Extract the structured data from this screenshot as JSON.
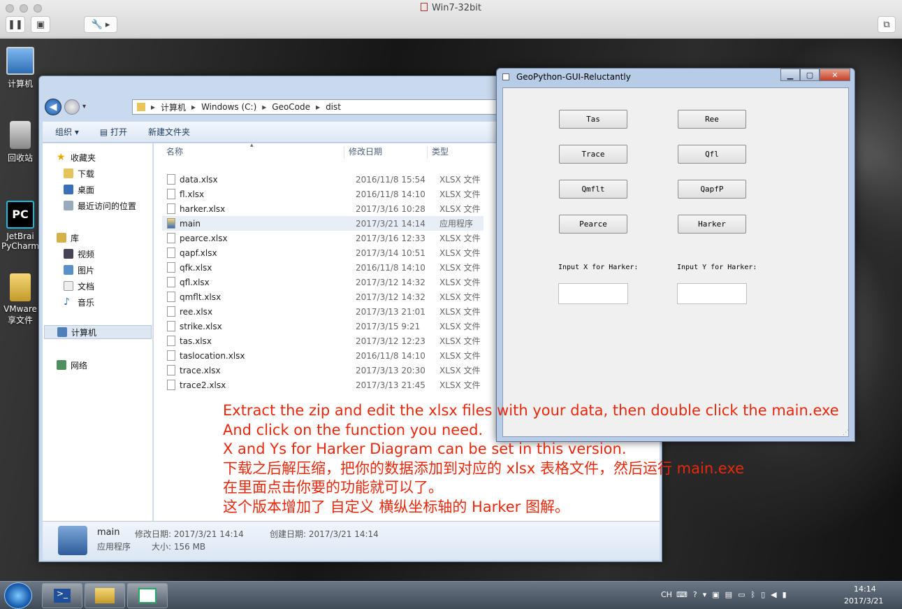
{
  "host": {
    "title": "Win7-32bit"
  },
  "desktop": {
    "icons": [
      "计算机",
      "回收站",
      "JetBrains PyCharm",
      "VMware 共享文件夹"
    ],
    "icon_labels_visible": [
      "计算机",
      "回收站",
      "JetBrai",
      "PyCharm",
      "VMware",
      "享文件"
    ]
  },
  "explorer": {
    "breadcrumb": [
      "计算机",
      "Windows (C:)",
      "GeoCode",
      "dist"
    ],
    "toolbar": {
      "organize": "组织",
      "open": "打开",
      "new_folder": "新建文件夹"
    },
    "nav": {
      "favorites": "收藏夹",
      "downloads": "下载",
      "desktop": "桌面",
      "recent": "最近访问的位置",
      "libraries": "库",
      "videos": "视频",
      "pictures": "图片",
      "documents": "文档",
      "music": "音乐",
      "computer": "计算机",
      "network": "网络"
    },
    "columns": {
      "name": "名称",
      "date": "修改日期",
      "type": "类型"
    },
    "files": [
      {
        "name": "data.xlsx",
        "date": "2016/11/8 15:54",
        "type": "XLSX 文件"
      },
      {
        "name": "fl.xlsx",
        "date": "2016/11/8 14:10",
        "type": "XLSX 文件"
      },
      {
        "name": "harker.xlsx",
        "date": "2017/3/16 10:28",
        "type": "XLSX 文件"
      },
      {
        "name": "main",
        "date": "2017/3/21 14:14",
        "type": "应用程序"
      },
      {
        "name": "pearce.xlsx",
        "date": "2017/3/16 12:33",
        "type": "XLSX 文件"
      },
      {
        "name": "qapf.xlsx",
        "date": "2017/3/14 10:51",
        "type": "XLSX 文件"
      },
      {
        "name": "qfk.xlsx",
        "date": "2016/11/8 14:10",
        "type": "XLSX 文件"
      },
      {
        "name": "qfl.xlsx",
        "date": "2017/3/12 14:32",
        "type": "XLSX 文件"
      },
      {
        "name": "qmflt.xlsx",
        "date": "2017/3/12 14:32",
        "type": "XLSX 文件"
      },
      {
        "name": "ree.xlsx",
        "date": "2017/3/13 21:01",
        "type": "XLSX 文件"
      },
      {
        "name": "strike.xlsx",
        "date": "2017/3/15 9:21",
        "type": "XLSX 文件"
      },
      {
        "name": "tas.xlsx",
        "date": "2017/3/12 12:23",
        "type": "XLSX 文件"
      },
      {
        "name": "taslocation.xlsx",
        "date": "2016/11/8 14:10",
        "type": "XLSX 文件"
      },
      {
        "name": "trace.xlsx",
        "date": "2017/3/13 20:30",
        "type": "XLSX 文件"
      },
      {
        "name": "trace2.xlsx",
        "date": "2017/3/13 21:45",
        "type": "XLSX 文件"
      }
    ],
    "details": {
      "name": "main",
      "modified": "修改日期: 2017/3/21 14:14",
      "created": "创建日期: 2017/3/21 14:14",
      "kind": "应用程序",
      "size": "大小: 156 MB"
    }
  },
  "app": {
    "title": "GeoPython-GUI-Reluctantly",
    "buttons": [
      "Tas",
      "Ree",
      "Trace",
      "Qfl",
      "Qmflt",
      "QapfP",
      "Pearce",
      "Harker"
    ],
    "label_x": "Input X for Harker:",
    "label_y": "Input Y for Harker:",
    "input_x": "",
    "input_y": ""
  },
  "overlay": [
    "Extract the zip and edit the xlsx files with your data, then double click the main.exe",
    "And click on the function you need.",
    "X and Ys for Harker Diagram can be set in this version.",
    "下载之后解压缩，把你的数据添加到对应的 xlsx 表格文件，然后运行 main.exe",
    "在里面点击你要的功能就可以了。",
    "这个版本增加了 自定义 横纵坐标轴的 Harker 图解。"
  ],
  "taskbar": {
    "lang": "CH",
    "time": "14:14",
    "date": "2017/3/21"
  },
  "colors": {
    "overlay": "#e8280c",
    "win7_glass": "#b7cce7"
  }
}
